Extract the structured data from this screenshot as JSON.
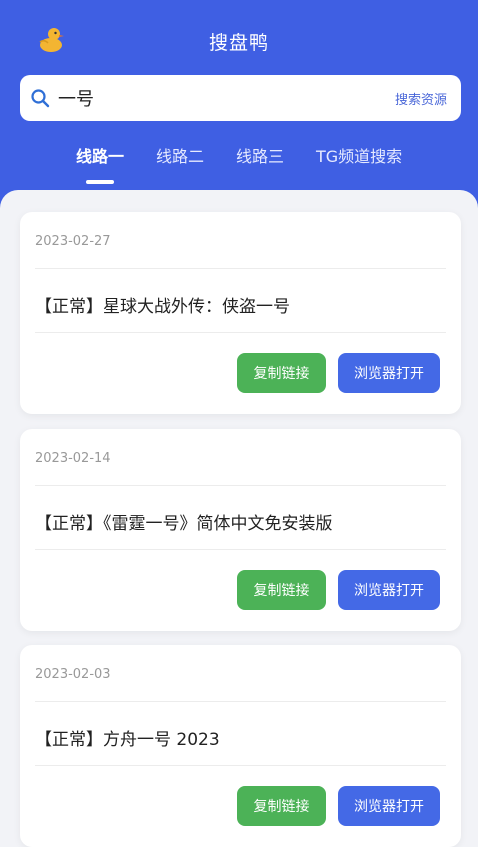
{
  "header": {
    "app_title": "搜盘鸭",
    "bg_color": "#3f5fe3",
    "logo_icon": "duck-icon"
  },
  "search": {
    "value": "一号",
    "button_label": "搜索资源",
    "icon": "search-icon"
  },
  "tabs": [
    {
      "label": "线路一",
      "active": true
    },
    {
      "label": "线路二",
      "active": false
    },
    {
      "label": "线路三",
      "active": false
    },
    {
      "label": "TG频道搜索",
      "active": false
    }
  ],
  "results": [
    {
      "date": "2023-02-27",
      "title": "【正常】星球大战外传：侠盗一号",
      "copy_label": "复制链接",
      "open_label": "浏览器打开"
    },
    {
      "date": "2023-02-14",
      "title": "【正常】《雷霆一号》简体中文免安装版",
      "copy_label": "复制链接",
      "open_label": "浏览器打开"
    },
    {
      "date": "2023-02-03",
      "title": "【正常】方舟一号 2023",
      "copy_label": "复制链接",
      "open_label": "浏览器打开"
    }
  ],
  "colors": {
    "copy_button": "#4cb257",
    "open_button": "#4469e6",
    "accent": "#4a67d8"
  }
}
